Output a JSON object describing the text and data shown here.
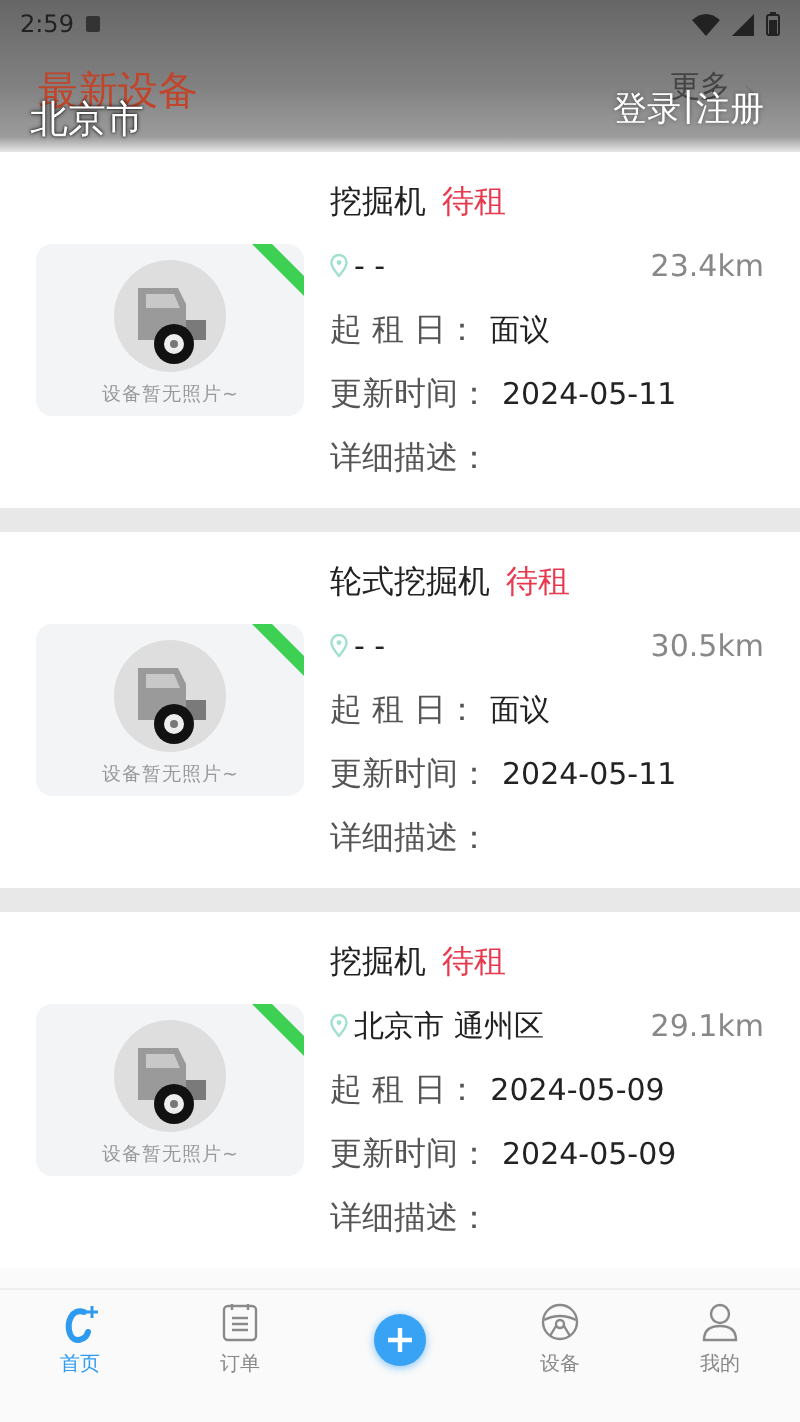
{
  "status_bar": {
    "time": "2:59"
  },
  "header": {
    "title": "最新设备",
    "city": "北京市",
    "more": "更多",
    "login": "登录",
    "divider": "|",
    "register": "注册"
  },
  "cards": [
    {
      "photo_caption": "设备暂无照片~",
      "title": "挖掘机",
      "status": "待租",
      "location": "- -",
      "distance": "23.4km",
      "rows": [
        {
          "label": "起 租 日：",
          "value": "面议"
        },
        {
          "label": "更新时间：",
          "value": "2024-05-11"
        },
        {
          "label": "详细描述："
        }
      ]
    },
    {
      "photo_caption": "设备暂无照片~",
      "title": "轮式挖掘机",
      "status": "待租",
      "location": "- -",
      "distance": "30.5km",
      "rows": [
        {
          "label": "起 租 日：",
          "value": "面议"
        },
        {
          "label": "更新时间：",
          "value": "2024-05-11"
        },
        {
          "label": "详细描述："
        }
      ]
    },
    {
      "photo_caption": "设备暂无照片~",
      "title": "挖掘机",
      "status": "待租",
      "location": "北京市 通州区",
      "distance": "29.1km",
      "rows": [
        {
          "label": "起 租 日：",
          "value": "2024-05-09"
        },
        {
          "label": "更新时间：",
          "value": "2024-05-09"
        },
        {
          "label": "详细描述："
        }
      ]
    }
  ],
  "tabs": [
    {
      "kind": "home",
      "label": "首页",
      "selected": true
    },
    {
      "kind": "orders",
      "label": "订单",
      "selected": false
    },
    {
      "kind": "add",
      "selected": false
    },
    {
      "kind": "devices",
      "label": "设备",
      "selected": false
    },
    {
      "kind": "mine",
      "label": "我的",
      "selected": false
    }
  ]
}
